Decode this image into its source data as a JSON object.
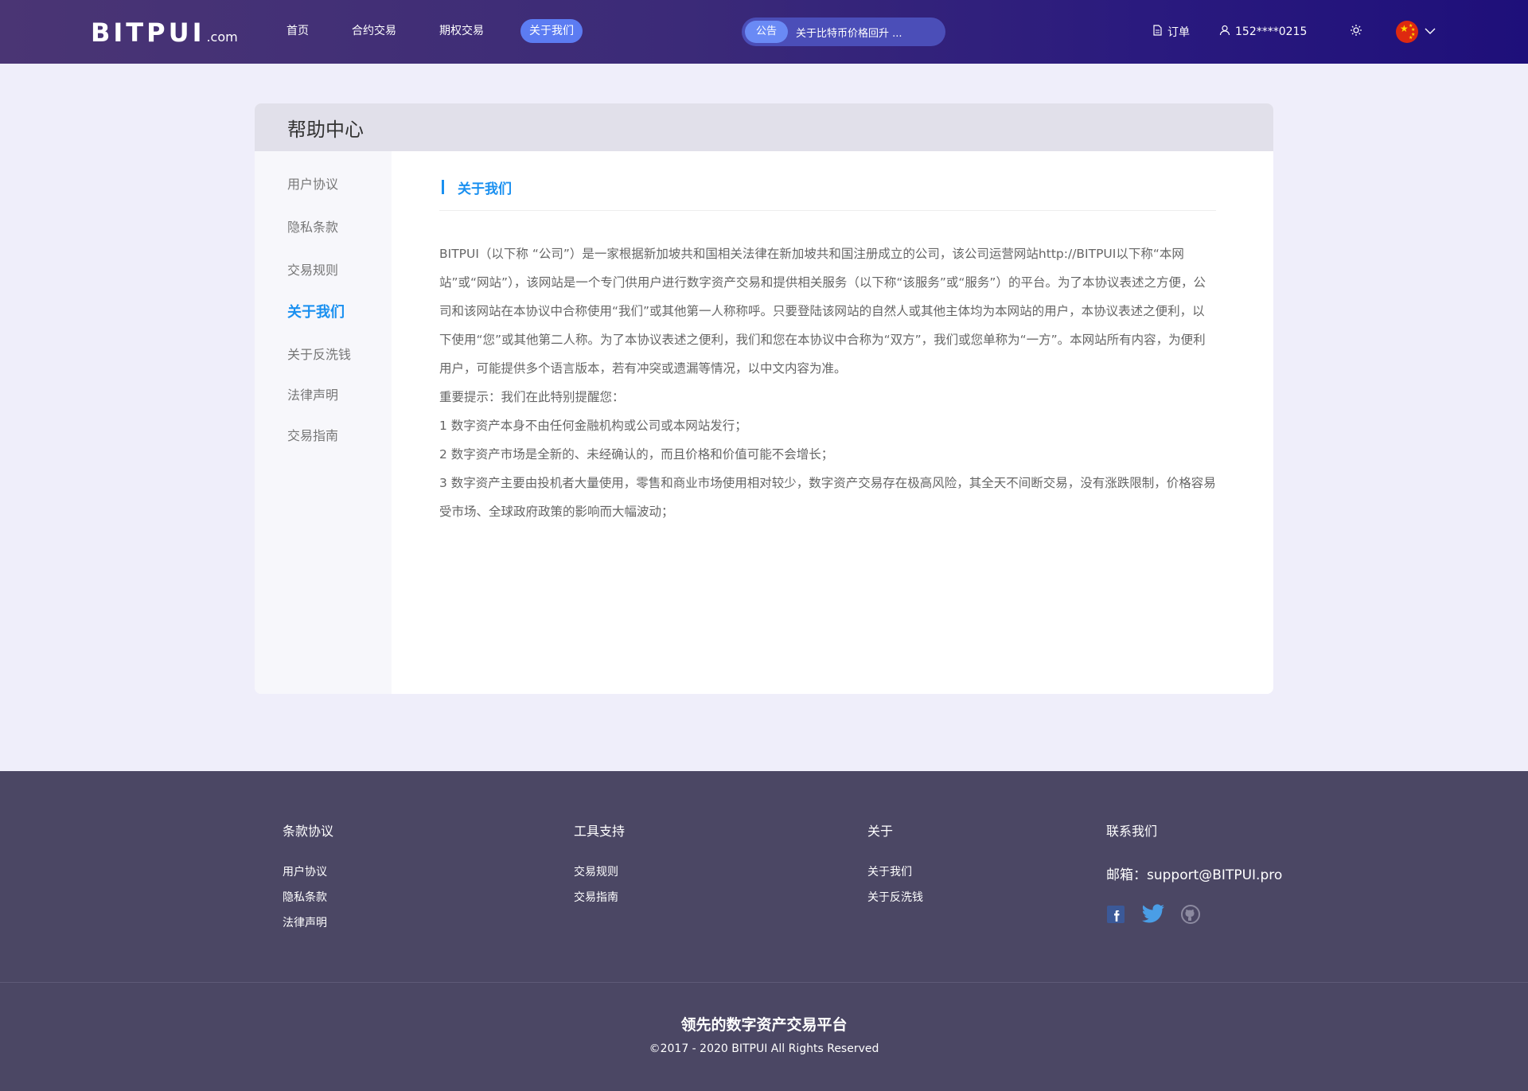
{
  "header": {
    "logo_main": "BITPUI",
    "logo_suffix": ".com",
    "nav": [
      "首页",
      "合约交易",
      "期权交易",
      "关于我们"
    ],
    "notice_badge": "公告",
    "notice_text": "关于比特币价格回升 ...",
    "orders": "订单",
    "user": "152****0215"
  },
  "card": {
    "title": "帮助中心",
    "sidebar": [
      "用户协议",
      "隐私条款",
      "交易规则",
      "关于我们",
      "关于反洗钱",
      "法律声明",
      "交易指南"
    ],
    "section_title": "关于我们",
    "paragraphs": [
      "BITPUI（以下称 “公司”）是一家根据新加坡共和国相关法律在新加坡共和国注册成立的公司，该公司运营网站http://BITPUI以下称“本网站”或“网站”），该网站是一个专门供用户进行数字资产交易和提供相关服务（以下称“该服务”或“服务”）的平台。为了本协议表述之方便，公司和该网站在本协议中合称使用“我们”或其他第一人称称呼。只要登陆该网站的自然人或其他主体均为本网站的用户，本协议表述之便利，以下使用“您”或其他第二人称。为了本协议表述之便利，我们和您在本协议中合称为“双方”，我们或您单称为“一方”。本网站所有内容，为便利用户，可能提供多个语言版本，若有冲突或遗漏等情况，以中文内容为准。",
      "重要提示：我们在此特别提醒您：",
      "1 数字资产本身不由任何金融机构或公司或本网站发行；",
      "2 数字资产市场是全新的、未经确认的，而且价格和价值可能不会增长；",
      "3 数字资产主要由投机者大量使用，零售和商业市场使用相对较少，数字资产交易存在极高风险，其全天不间断交易，没有涨跌限制，价格容易受市场、全球政府政策的影响而大幅波动；"
    ]
  },
  "footer": {
    "col1_title": "条款协议",
    "col1_links": [
      "用户协议",
      "隐私条款",
      "法律声明"
    ],
    "col2_title": "工具支持",
    "col2_links": [
      "交易规则",
      "交易指南"
    ],
    "col3_title": "关于",
    "col3_links": [
      "关于我们",
      "关于反洗钱"
    ],
    "col4_title": "联系我们",
    "email": "邮箱：support@BITPUI.pro",
    "slogan": "领先的数字资产交易平台",
    "copyright": "©2017 - 2020 BITPUI All Rights Reserved"
  },
  "icons": {
    "orders": "document-icon",
    "user": "user-icon",
    "theme": "sun-icon",
    "language": "china-flag-icon",
    "dropdown": "chevron-down-icon",
    "social": [
      "facebook-icon",
      "twitter-icon",
      "github-icon"
    ]
  },
  "colors": {
    "accent": "#1a90f0",
    "nav_active": "#5c7cf2",
    "footer_bg": "#4b4764",
    "page_bg": "#efeefa"
  }
}
